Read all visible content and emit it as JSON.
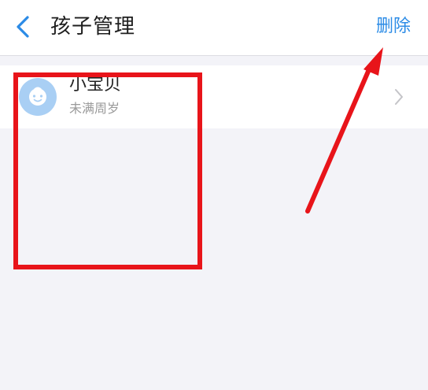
{
  "header": {
    "title": "孩子管理",
    "delete_label": "删除"
  },
  "child": {
    "name": "小宝贝",
    "age_status": "未满周岁",
    "avatar_icon": "baby-face-icon"
  },
  "colors": {
    "accent": "#2b8be6",
    "annotation": "#e8141a",
    "avatar": "#a9cff4"
  }
}
